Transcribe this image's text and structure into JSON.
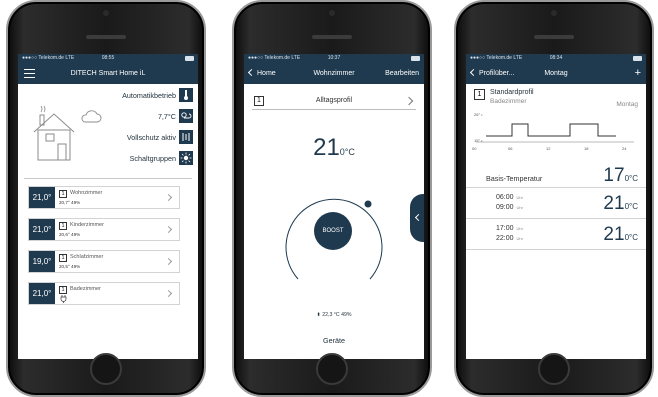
{
  "screen1": {
    "status": {
      "carrier": "●●●○○ Telekom.de  LTE",
      "time": "08:55"
    },
    "nav": {
      "title": "DITECH Smart Home iL"
    },
    "overview": {
      "auto_label": "Automatikbetrieb",
      "outside_temp": "7,7°C",
      "protection_label": "Vollschutz aktiv",
      "groups_label": "Schaltgruppen"
    },
    "rooms": [
      {
        "num": "1",
        "temp": "21,0°",
        "name": "Wohnzimmer",
        "meta": "20,7° 49%"
      },
      {
        "num": "1",
        "temp": "21,0°",
        "name": "Kinderzimmer",
        "meta": "20,6° 49%"
      },
      {
        "num": "1",
        "temp": "19,0°",
        "name": "Schlafzimmer",
        "meta": "20,5° 49%"
      },
      {
        "num": "1",
        "temp": "21,0°",
        "name": "Badezimmer",
        "meta": ""
      }
    ]
  },
  "screen2": {
    "status": {
      "carrier": "●●●○○ Telekom.de  LTE",
      "time": "10:37"
    },
    "nav": {
      "back": "Home",
      "title": "Wohnzimmer",
      "action": "Bearbeiten"
    },
    "profile": {
      "num": "1",
      "name": "Alltagsprofil"
    },
    "setpoint": {
      "value": "21",
      "unit": "0°C"
    },
    "boost_label": "BOOST",
    "sensor": "22,3 °C  49%",
    "devices_label": "Geräte"
  },
  "screen3": {
    "status": {
      "carrier": "●●●○○ Telekom.de  LTE",
      "time": "08:34"
    },
    "nav": {
      "back": "Profilüber...",
      "title": "Montag",
      "action": "+"
    },
    "profile": {
      "num": "1",
      "title": "Standardprofil",
      "room": "Badezimmer",
      "day": "Montag"
    },
    "chart": {
      "y_labels": [
        "26° •",
        "15° •"
      ],
      "x_labels": [
        "00",
        "06",
        "12",
        "18",
        "24"
      ]
    },
    "basis": {
      "label": "Basis-Temperatur",
      "value": "17",
      "unit": "0°C"
    },
    "periods": [
      {
        "start": "06:00",
        "end": "09:00",
        "uhr": "Uhr",
        "value": "21",
        "unit": "0°C"
      },
      {
        "start": "17:00",
        "end": "22:00",
        "uhr": "Uhr",
        "value": "21",
        "unit": "0°C"
      }
    ]
  },
  "colors": {
    "navy": "#1f3a4f",
    "text": "#1f2f3a"
  }
}
